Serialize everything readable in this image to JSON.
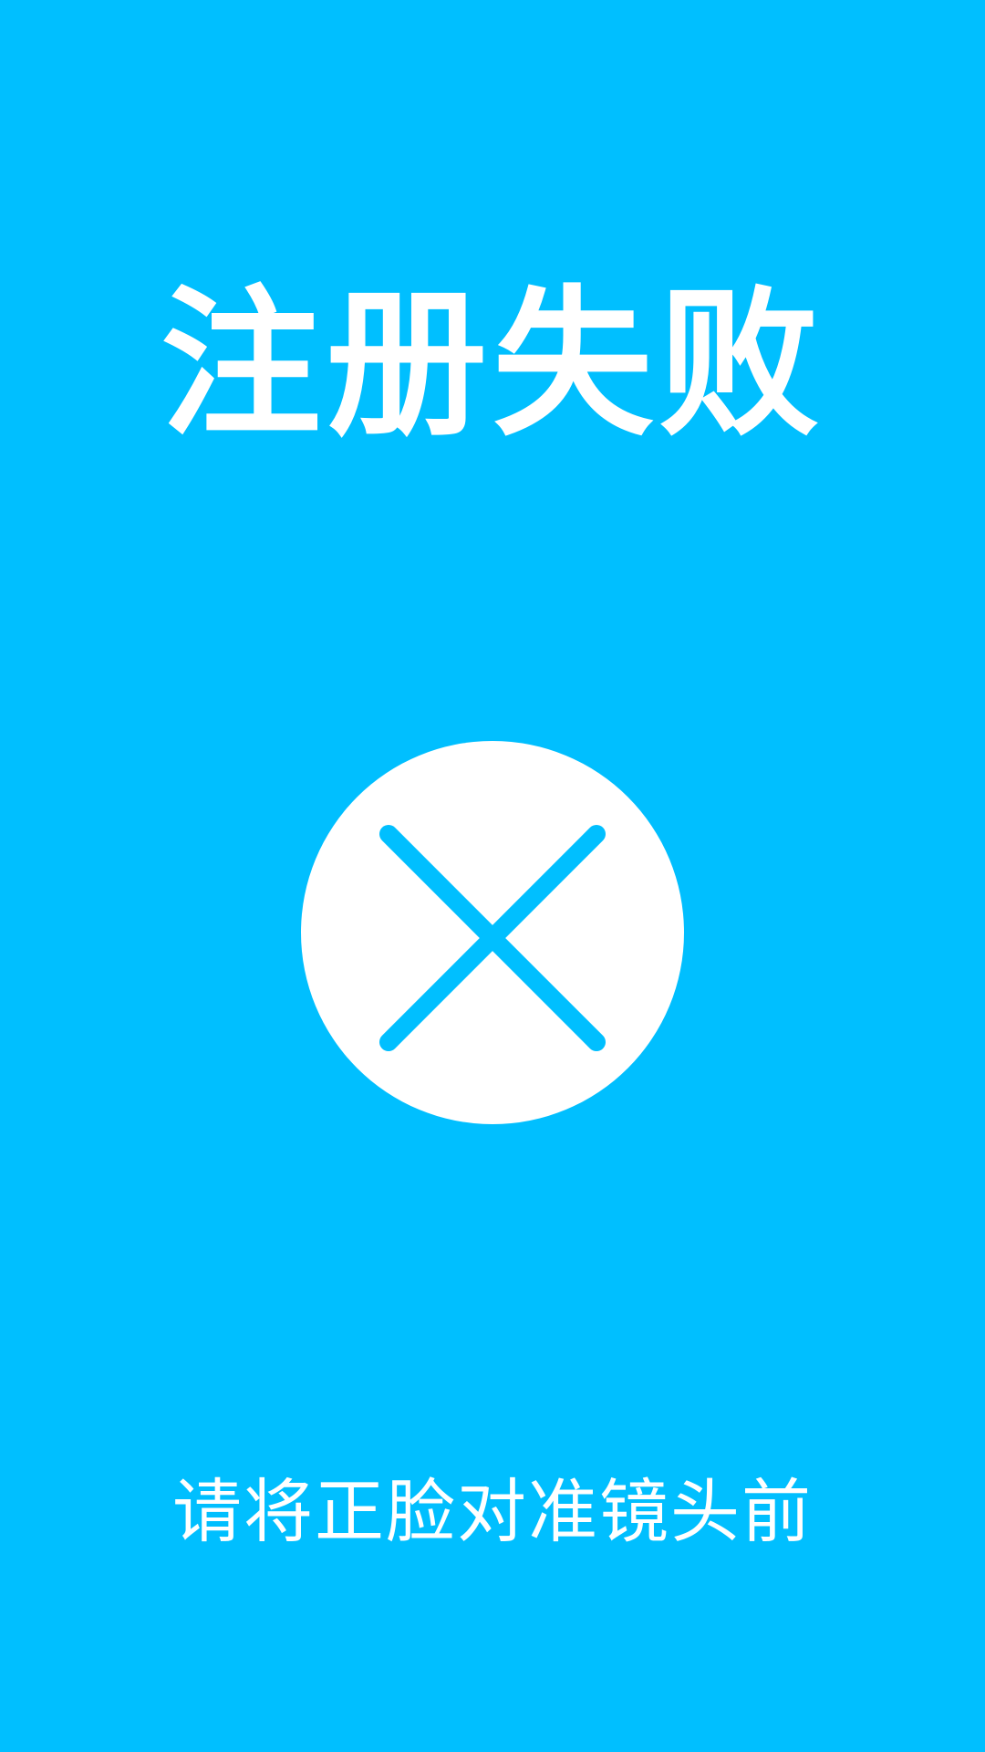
{
  "screen": {
    "title": "注册失败",
    "status_icon": "close-circle-icon",
    "instruction": "请将正脸对准镜头前"
  },
  "colors": {
    "background": "#00BFFF",
    "foreground": "#FFFFFF"
  }
}
